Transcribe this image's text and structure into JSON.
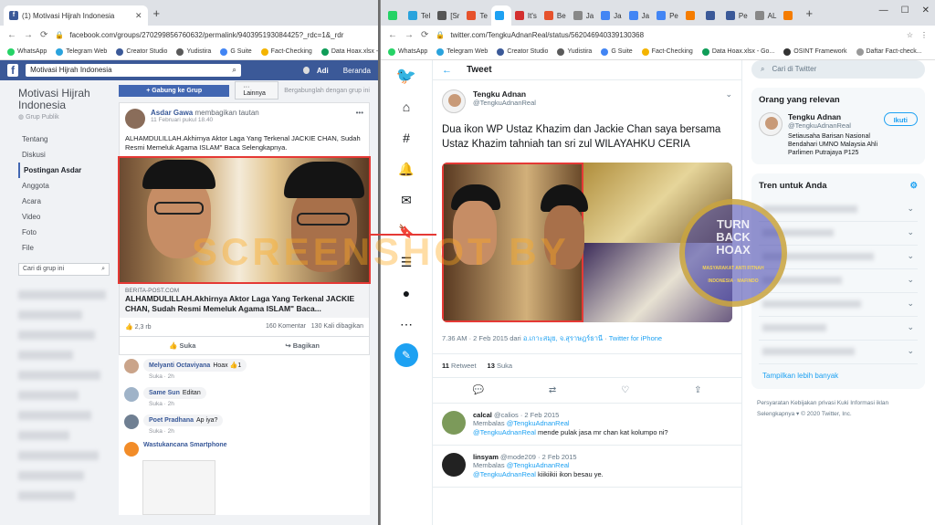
{
  "left": {
    "tab_title": "(1) Motivasi Hijrah Indonesia",
    "url": "facebook.com/groups/270299856760632/permalink/940395193084425?_rdc=1&_rdr",
    "bookmarks": [
      "WhatsApp",
      "Telegram Web",
      "Creator Studio",
      "Yudistira",
      "G Suite",
      "Fact-Checking",
      "Data Hoax.xlsx - Go..."
    ],
    "fb": {
      "search_value": "Motivasi Hijrah Indonesia",
      "user": "Adi",
      "beranda": "Beranda",
      "group_name": "Motivasi Hijrah Indonesia",
      "group_type": "Grup Publik",
      "menu": [
        "Tentang",
        "Diskusi",
        "Postingan Asdar",
        "Anggota",
        "Acara",
        "Video",
        "Foto",
        "File"
      ],
      "find_placeholder": "Cari di grup ini",
      "join_btn": "+ Gabung ke Grup",
      "more_btn": "··· Lainnya",
      "join_note": "Bergabunglah dengan grup ini",
      "post": {
        "author": "Asdar Gawa",
        "action": "membagikan tautan",
        "time": "11 Februari pukul 18.40",
        "text": "ALHAMDULILLAH.Akhirnya Aktor Laga Yang Terkenal JACKIE CHAN, Sudah Resmi Memeluk Agama ISLAM\" Baca Selengkapnya.",
        "link_domain": "BERITA-POST.COM",
        "link_title": "ALHAMDULILLAH.Akhirnya Aktor Laga Yang Terkenal JACKIE CHAN, Sudah Resmi Memeluk Agama ISLAM\" Baca...",
        "reactions": "2,3 rb",
        "comments_count": "160 Komentar",
        "shares": "130 Kali dibagikan",
        "like": "Suka",
        "share": "Bagikan"
      },
      "comments": [
        {
          "name": "Melyanti Octaviyana",
          "text": "Hoax",
          "meta": "Suka · 2h",
          "react": "1"
        },
        {
          "name": "Same Sun",
          "text": "Editan",
          "meta": "Suka · 2h"
        },
        {
          "name": "Poet Pradhana",
          "text": "Ap iya?",
          "meta": "Suka · 2h"
        },
        {
          "name": "Wastukancana Smartphone",
          "text": "",
          "meta": ""
        }
      ]
    }
  },
  "right": {
    "tabs": [
      "",
      "Tel",
      "[Sr",
      "Te",
      "",
      "It's",
      "Be",
      "Ja",
      "Ja",
      "Ja",
      "Pe",
      "",
      "",
      "Pe",
      "AL",
      ""
    ],
    "url": "twitter.com/TengkuAdnanReal/status/562046940339130368",
    "bookmarks": [
      "WhatsApp",
      "Telegram Web",
      "Creator Studio",
      "Yudistira",
      "G Suite",
      "Fact-Checking",
      "Data Hoax.xlsx - Go...",
      "OSINT Framework",
      "Daftar Fact-check..."
    ],
    "header": "Tweet",
    "tweet": {
      "name": "Tengku Adnan",
      "handle": "@TengkuAdnanReal",
      "text": "Dua ikon WP Ustaz Khazim dan Jackie Chan saya bersama Ustaz Khazim  tahniah tan sri zul WILAYAHKU CERIA",
      "time": "7.36 AM · 2 Feb 2015 dari ",
      "place": "อ.เกาะสมุย, จ.สุราษฎร์ธานี",
      "sep": " · ",
      "client": "Twitter for iPhone",
      "retweets": "11",
      "retweets_label": "Retweet",
      "likes": "13",
      "likes_label": "Suka"
    },
    "replies": [
      {
        "name": "calcal",
        "handle": "@calios · 2 Feb 2015",
        "reply_prefix": "Membalas ",
        "reply_to": "@TengkuAdnanReal",
        "mention": "@TengkuAdnanReal",
        "text": " mende pulak jasa mr chan kat kolumpo ni?"
      },
      {
        "name": "linsyam",
        "handle": "@mode209 · 2 Feb 2015",
        "reply_prefix": "Membalas ",
        "reply_to": "@TengkuAdnanReal",
        "mention": "@TengkuAdnanReal",
        "text": " kiikiikii ikon besau ye."
      }
    ],
    "search_placeholder": "Cari di Twitter",
    "relevant_title": "Orang yang relevan",
    "relevant": {
      "name": "Tengku Adnan",
      "handle": "@TengkuAdnanReal",
      "bio": "Setiausaha Barisan Nasional Bendahari UMNO Malaysia Ahli Parlimen Putrajaya P125",
      "follow": "Ikuti"
    },
    "trends_title": "Tren untuk Anda",
    "show_more": "Tampilkan lebih banyak",
    "footer": "Persyaratan  Kebijakan privasi  Kuki  Informasi iklan  Selengkapnya ▾  © 2020 Twitter, Inc."
  },
  "watermark": "SCREENSHOT BY",
  "badge": {
    "top": "TURN",
    "mid": "BACK",
    "bot": "HOAX",
    "ring": "MASYARAKAT ANTI FITNAH INDONESIA · MAFINDO"
  },
  "colors": {
    "fb_blue": "#3b5998",
    "tw_blue": "#1da1f2",
    "highlight_red": "#e53935"
  }
}
